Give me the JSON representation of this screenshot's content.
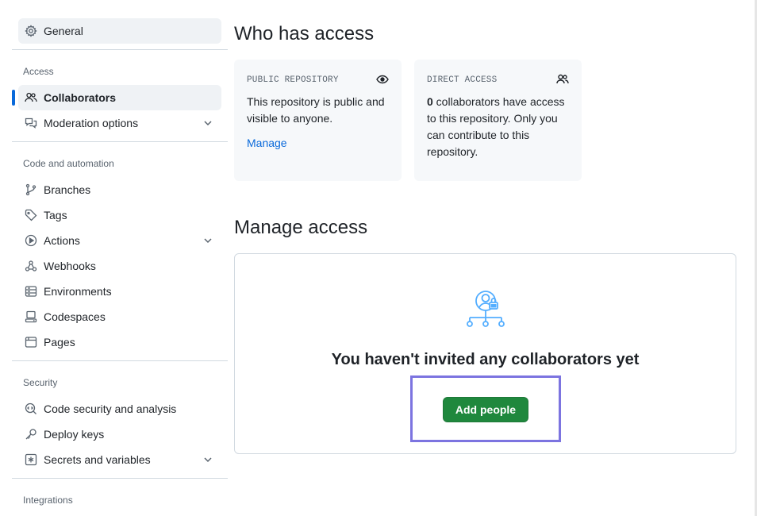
{
  "sidebar": {
    "top_item": {
      "label": "General",
      "icon": "gear-icon"
    },
    "groups": {
      "access": "Access",
      "code_automation": "Code and automation",
      "security": "Security",
      "integrations": "Integrations"
    },
    "items": {
      "collaborators": {
        "label": "Collaborators",
        "icon": "people-icon",
        "active": true
      },
      "moderation": {
        "label": "Moderation options",
        "icon": "comment-discussion-icon"
      },
      "branches": {
        "label": "Branches",
        "icon": "git-branch-icon"
      },
      "tags": {
        "label": "Tags",
        "icon": "tag-icon"
      },
      "actions": {
        "label": "Actions",
        "icon": "play-icon"
      },
      "webhooks": {
        "label": "Webhooks",
        "icon": "webhook-icon"
      },
      "environments": {
        "label": "Environments",
        "icon": "server-icon"
      },
      "codespaces": {
        "label": "Codespaces",
        "icon": "codespaces-icon"
      },
      "pages": {
        "label": "Pages",
        "icon": "browser-icon"
      },
      "code_security": {
        "label": "Code security and analysis",
        "icon": "codescan-icon"
      },
      "deploy_keys": {
        "label": "Deploy keys",
        "icon": "key-icon"
      },
      "secrets": {
        "label": "Secrets and variables",
        "icon": "key-asterisk-icon"
      }
    }
  },
  "main": {
    "who_has_access_title": "Who has access",
    "public_card": {
      "heading": "PUBLIC REPOSITORY",
      "icon": "eye-icon",
      "text": "This repository is public and visible to anyone.",
      "link": "Manage"
    },
    "direct_card": {
      "heading": "DIRECT ACCESS",
      "icon": "people-icon",
      "count": "0",
      "text": " collaborators have access to this repository. Only you can contribute to this repository."
    },
    "manage_access_title": "Manage access",
    "empty_state": {
      "icon": "person-lock-network-icon",
      "title": "You haven't invited any collaborators yet",
      "button": "Add people"
    }
  },
  "colors": {
    "accent_blue": "#0969da",
    "primary_green": "#1f883d",
    "highlight_purple": "#7c74e0",
    "illustration_blue": "#54aeff"
  }
}
